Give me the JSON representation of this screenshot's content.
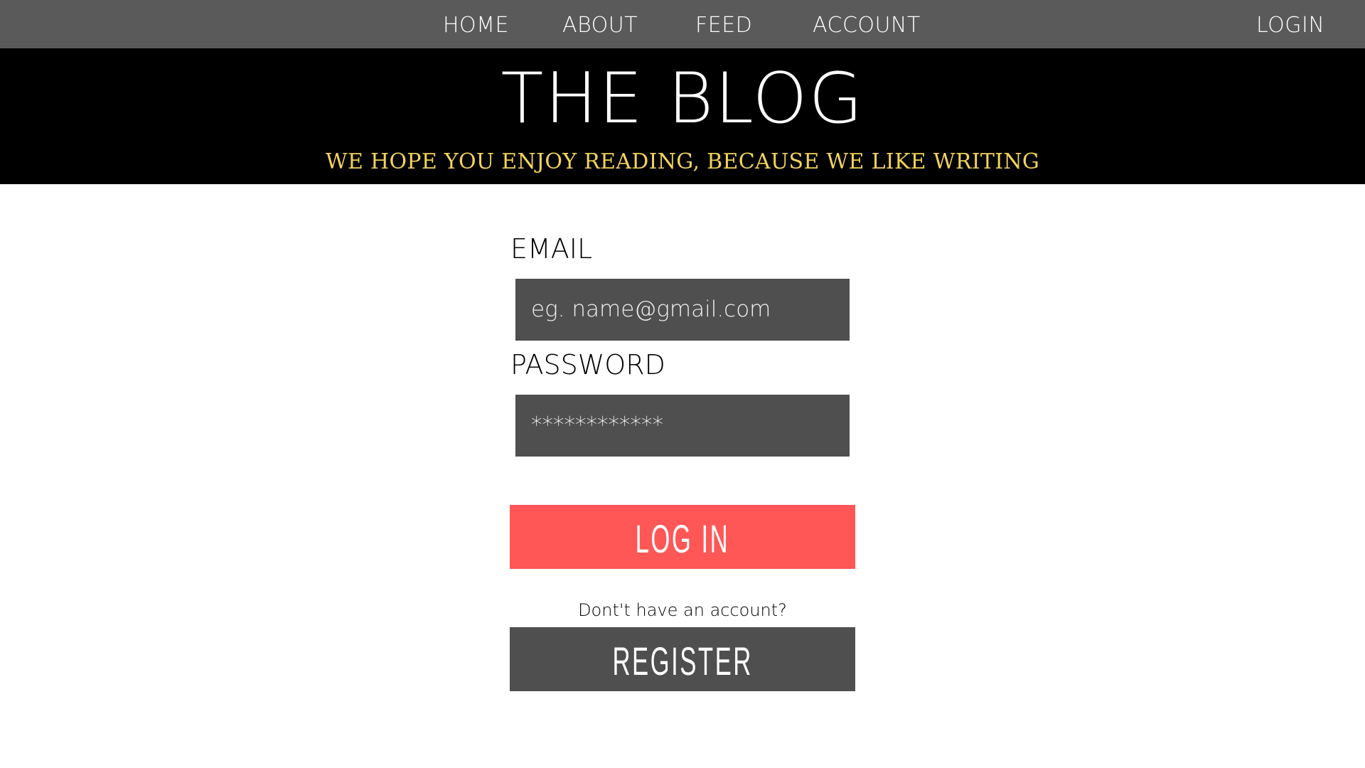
{
  "nav": {
    "items": [
      {
        "label": "HOME"
      },
      {
        "label": "ABOUT"
      },
      {
        "label": "FEED"
      },
      {
        "label": "ACCOUNT"
      }
    ],
    "login_label": "LOGIN"
  },
  "hero": {
    "title": "THE BLOG",
    "tagline": "WE HOPE YOU ENJOY READING, BECAUSE WE LIKE WRITING"
  },
  "form": {
    "email_label": "EMAIL",
    "email_placeholder": "eg. name@gmail.com",
    "password_label": "PASSWORD",
    "password_value": "************",
    "login_button": "LOG IN",
    "no_account_text": "Dont't have an account?",
    "register_button": "REGISTER"
  },
  "colors": {
    "nav_bg": "#5a5a5a",
    "hero_bg": "#000000",
    "tagline": "#f2d35b",
    "field_bg": "#4f4f4f",
    "login_button_bg": "#ff5656",
    "register_button_bg": "#4f4f4f"
  }
}
